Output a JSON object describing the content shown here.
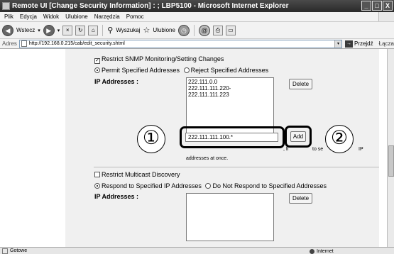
{
  "window": {
    "title": "Remote UI [Change Security Information] : ; LBP5100 - Microsoft Internet Explorer",
    "controls": [
      "_",
      "□",
      "X"
    ]
  },
  "menu": [
    "Plik",
    "Edycja",
    "Widok",
    "Ulubione",
    "Narzędzia",
    "Pomoc"
  ],
  "toolbar": {
    "back_label": "Wstecz",
    "search_label": "Wyszukaj",
    "favorites_label": "Ulubione"
  },
  "address": {
    "label": "Adres",
    "url": "http://192.168.0.215/cab/edit_security.shtml",
    "go_label": "Przejdź",
    "links_label": "Łącza"
  },
  "snmp": {
    "checkbox_label": "Restrict SNMP Monitoring/Setting Changes",
    "radio_permit": "Permit Specified Addresses",
    "radio_reject": "Reject Specified Addresses",
    "ip_label": "IP Addresses :",
    "ip_list": [
      "222.111.0.0",
      "222.111.111.220-222.111.111.223"
    ],
    "delete_label": "Delete",
    "input_value": "222.111.111.100.*",
    "add_label": "Add",
    "hint_fragment_1": ", fi",
    "hint_fragment_2": "to se",
    "hint_fragment_3": "IP",
    "hint_line2": "addresses at once."
  },
  "multicast": {
    "checkbox_label": "Restrict Multicast Discovery",
    "radio_respond": "Respond to Specified IP Addresses",
    "radio_no_respond": "Do Not Respond to Specified Addresses",
    "ip_label": "IP Addresses :",
    "delete_label": "Delete"
  },
  "callouts": {
    "one": "①",
    "two": "②"
  },
  "status": {
    "left": "Gotowe",
    "zone": "Internet"
  }
}
